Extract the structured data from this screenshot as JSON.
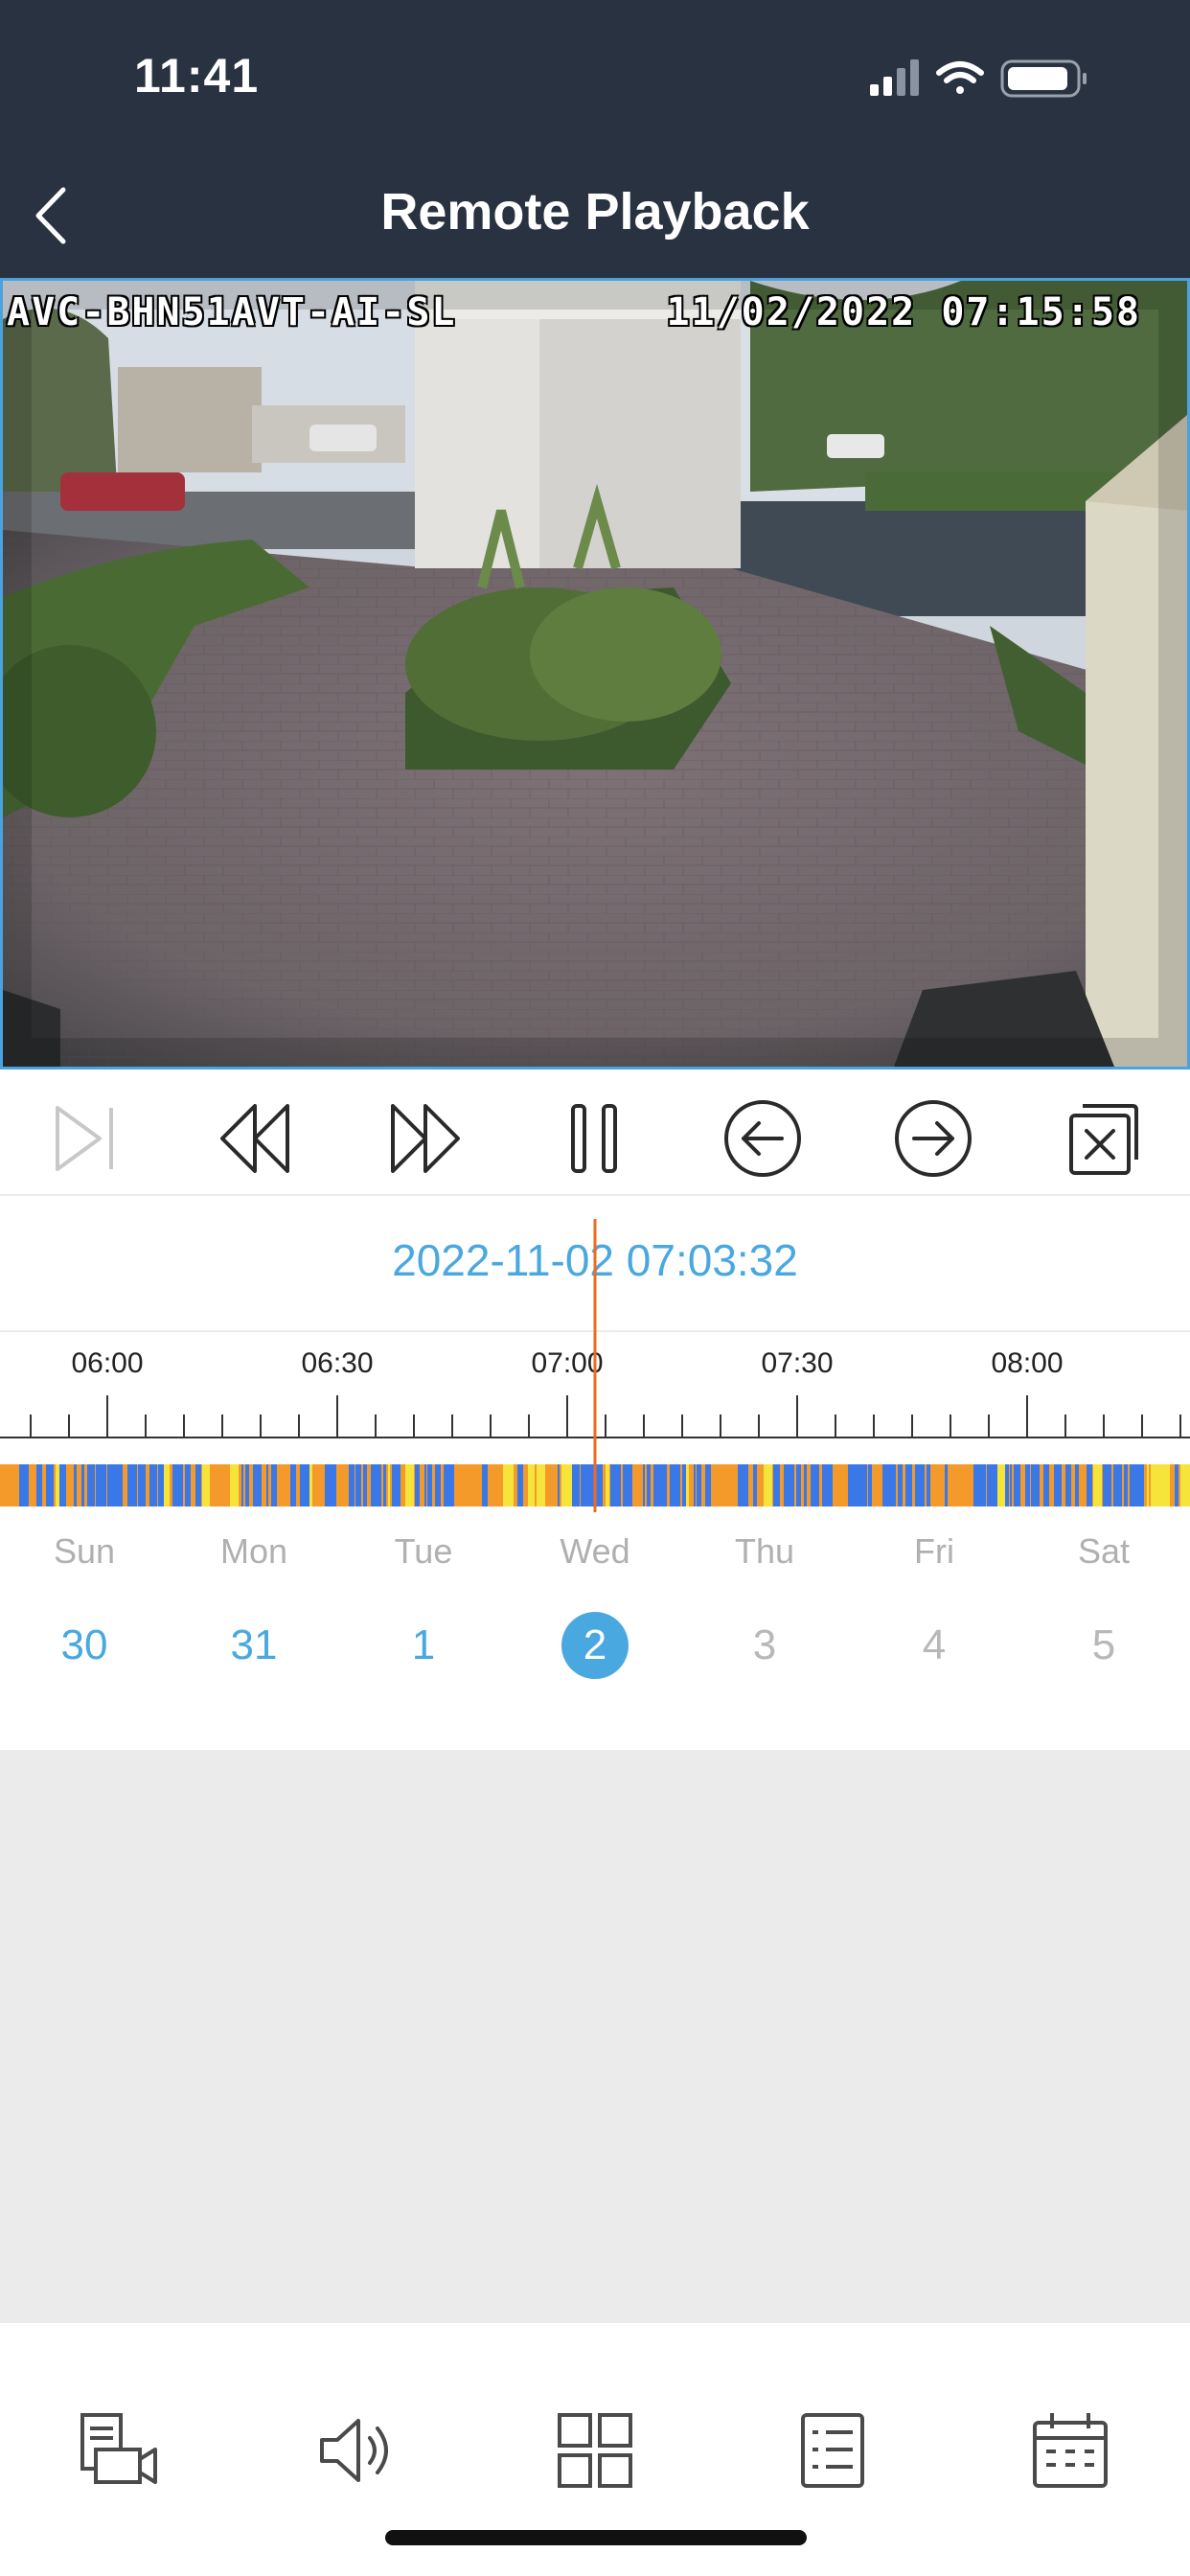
{
  "status_bar": {
    "time": "11:41"
  },
  "header": {
    "title": "Remote Playback"
  },
  "video": {
    "camera_name": "AVC-BHN51AVT-AI-SL",
    "timestamp": "11/02/2022 07:15:58"
  },
  "controls": [
    {
      "name": "skip-to-end-icon",
      "enabled": false
    },
    {
      "name": "rewind-icon",
      "enabled": true
    },
    {
      "name": "fast-forward-icon",
      "enabled": true
    },
    {
      "name": "pause-icon",
      "enabled": true
    },
    {
      "name": "previous-arrow-icon",
      "enabled": true
    },
    {
      "name": "next-arrow-icon",
      "enabled": true
    },
    {
      "name": "close-window-icon",
      "enabled": true
    }
  ],
  "timeline": {
    "current_time": "2022-11-02 07:03:32",
    "tick_labels": [
      "06:00",
      "06:30",
      "07:00",
      "07:30",
      "08:00"
    ],
    "colors": {
      "motion": "#f39a2b",
      "normal": "#3a78e8",
      "alarm": "#f7e43a",
      "cursor": "#f06a1e"
    }
  },
  "calendar": {
    "days": [
      {
        "name": "Sun",
        "num": "30",
        "state": "avail"
      },
      {
        "name": "Mon",
        "num": "31",
        "state": "avail"
      },
      {
        "name": "Tue",
        "num": "1",
        "state": "avail"
      },
      {
        "name": "Wed",
        "num": "2",
        "state": "selected"
      },
      {
        "name": "Thu",
        "num": "3",
        "state": "dim"
      },
      {
        "name": "Fri",
        "num": "4",
        "state": "dim"
      },
      {
        "name": "Sat",
        "num": "5",
        "state": "dim"
      }
    ],
    "accent": "#4aa8e0"
  },
  "tabbar": [
    {
      "name": "recording-video-icon"
    },
    {
      "name": "speaker-icon"
    },
    {
      "name": "grid-layout-icon"
    },
    {
      "name": "list-icon"
    },
    {
      "name": "calendar-icon"
    }
  ]
}
